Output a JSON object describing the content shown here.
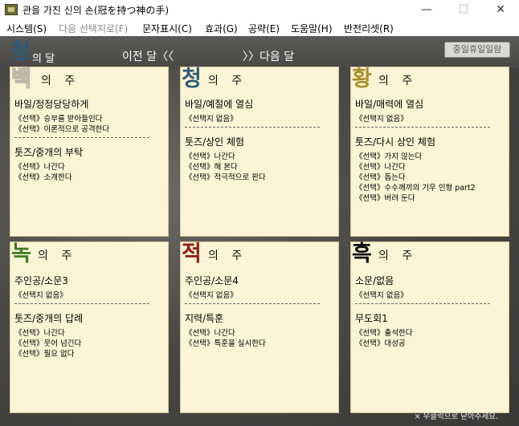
{
  "window": {
    "title": "관을 가진 신의 손(冠を持つ神の手)",
    "controls": {
      "minimize": "—",
      "maximize": "☐",
      "close": "✕"
    }
  },
  "menu": [
    {
      "label": "시스템(S)",
      "disabled": false
    },
    {
      "label": "다음 선택지로(F)",
      "disabled": true
    },
    {
      "label": "문자표시(C)",
      "disabled": false
    },
    {
      "label": "효과(G)",
      "disabled": false
    },
    {
      "label": "공략(E)",
      "disabled": false
    },
    {
      "label": "도움말(H)",
      "disabled": false
    },
    {
      "label": "반전리셋(R)",
      "disabled": false
    }
  ],
  "header": {
    "month_char": "청",
    "month_suffix": "의 달",
    "prev_label": "이전 달〈〈",
    "next_label": "〉〉다음 달",
    "holiday_button": "중일휴일일람"
  },
  "colors": {
    "blue": "#2e5a78",
    "white_char": "#ffffff",
    "gold": "#a78f2a",
    "green": "#3f7a23",
    "red": "#8e1f12",
    "black": "#111111"
  },
  "cards": [
    {
      "char": "백",
      "suffix": "의 주",
      "sections": [
        {
          "title": "바일/정정당당하게",
          "choices": [
            "《선택》승부를 받아들인다",
            "《선택》이론적으로 공격한다"
          ]
        },
        {
          "title": "툿즈/중개의 부탁",
          "choices": [
            "《선택》나간다",
            "《선택》소개한다"
          ]
        }
      ]
    },
    {
      "char": "청",
      "suffix": "의 주",
      "sections": [
        {
          "title": "바일/예절에 열심",
          "choices": [
            "《선택지 없음》"
          ]
        },
        {
          "title": "툿즈/상인 체험",
          "choices": [
            "《선택》나간다",
            "《선택》해 본다",
            "《선택》적극적으로 판다"
          ]
        }
      ]
    },
    {
      "char": "황",
      "suffix": "의 주",
      "sections": [
        {
          "title": "바일/매력에 열심",
          "choices": [
            "《선택지 없음》"
          ]
        },
        {
          "title": "툿즈/다시 상인 체험",
          "choices": [
            "《선택》가지 않는다",
            "《선택》나간다",
            "《선택》돕는다",
            "《선택》수수께끼의 기우 인형 part2",
            "《선택》버려 둔다"
          ]
        }
      ]
    },
    {
      "char": "녹",
      "suffix": "의 주",
      "sections": [
        {
          "title": "주인공/소문3",
          "choices": [
            "《선택지 없음》"
          ]
        },
        {
          "title": "툿즈/중개의 답례",
          "choices": [
            "《선택》나간다",
            "《선택》웃어 넘긴다",
            "《선택》필요 없다"
          ]
        }
      ]
    },
    {
      "char": "적",
      "suffix": "의 주",
      "sections": [
        {
          "title": "주인공/소문4",
          "choices": [
            "《선택지 없음》"
          ]
        },
        {
          "title": "지력/특훈",
          "choices": [
            "《선택》나간다",
            "《선택》특훈을 실시한다"
          ]
        }
      ]
    },
    {
      "char": "흑",
      "suffix": "의 주",
      "sections": [
        {
          "title": "소문/없음",
          "choices": [
            "《선택지 없음》"
          ]
        },
        {
          "title": "무도회1",
          "choices": [
            "《선택》출석한다",
            "《선택》대성공"
          ]
        }
      ]
    }
  ],
  "status": "× 우클릭으로 닫아주세요."
}
